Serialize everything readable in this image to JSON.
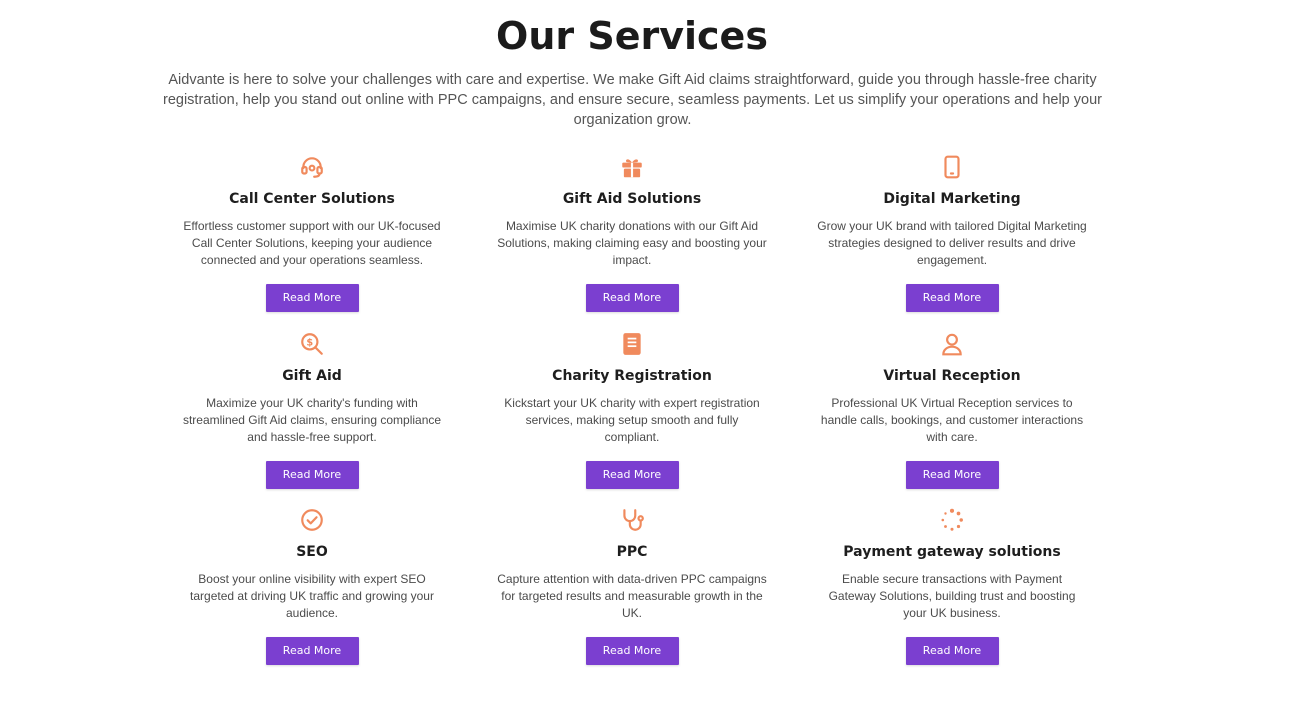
{
  "section": {
    "title": "Our Services",
    "intro": "Aidvante is here to solve your challenges with care and expertise. We make Gift Aid claims straightforward, guide you through hassle-free charity registration, help you stand out online with PPC campaigns, and ensure secure, seamless payments. Let us simplify your operations and help your organization grow."
  },
  "colors": {
    "accent_icon": "#f08a5d",
    "button_bg": "#7b3fd0",
    "button_text": "#ffffff"
  },
  "services": [
    {
      "icon": "headset-icon",
      "title": "Call Center Solutions",
      "description": "Effortless customer support with our UK-focused Call Center Solutions, keeping your audience connected and your operations seamless.",
      "button": "Read More"
    },
    {
      "icon": "gift-icon",
      "title": "Gift Aid Solutions",
      "description": "Maximise UK charity donations with our Gift Aid Solutions, making claiming easy and boosting your impact.",
      "button": "Read More"
    },
    {
      "icon": "mobile-phone-icon",
      "title": "Digital Marketing",
      "description": "Grow your UK brand with tailored Digital Marketing strategies designed to deliver results and drive engagement.",
      "button": "Read More"
    },
    {
      "icon": "search-dollar-icon",
      "title": "Gift Aid",
      "description": "Maximize your UK charity's funding with streamlined Gift Aid claims, ensuring compliance and hassle-free support.",
      "button": "Read More"
    },
    {
      "icon": "book-icon",
      "title": "Charity Registration",
      "description": "Kickstart your UK charity with expert registration services, making setup smooth and fully compliant.",
      "button": "Read More"
    },
    {
      "icon": "user-icon",
      "title": "Virtual Reception",
      "description": "Professional UK Virtual Reception services to handle calls, bookings, and customer interactions with care.",
      "button": "Read More"
    },
    {
      "icon": "check-circle-icon",
      "title": "SEO",
      "description": "Boost your online visibility with expert SEO targeted at driving UK traffic and growing your audience.",
      "button": "Read More"
    },
    {
      "icon": "stethoscope-icon",
      "title": "PPC",
      "description": "Capture attention with data-driven PPC campaigns for targeted results and measurable growth in the UK.",
      "button": "Read More"
    },
    {
      "icon": "spinner-icon",
      "title": "Payment gateway solutions",
      "description": "Enable secure transactions with Payment Gateway Solutions, building trust and boosting your UK business.",
      "button": "Read More"
    }
  ]
}
